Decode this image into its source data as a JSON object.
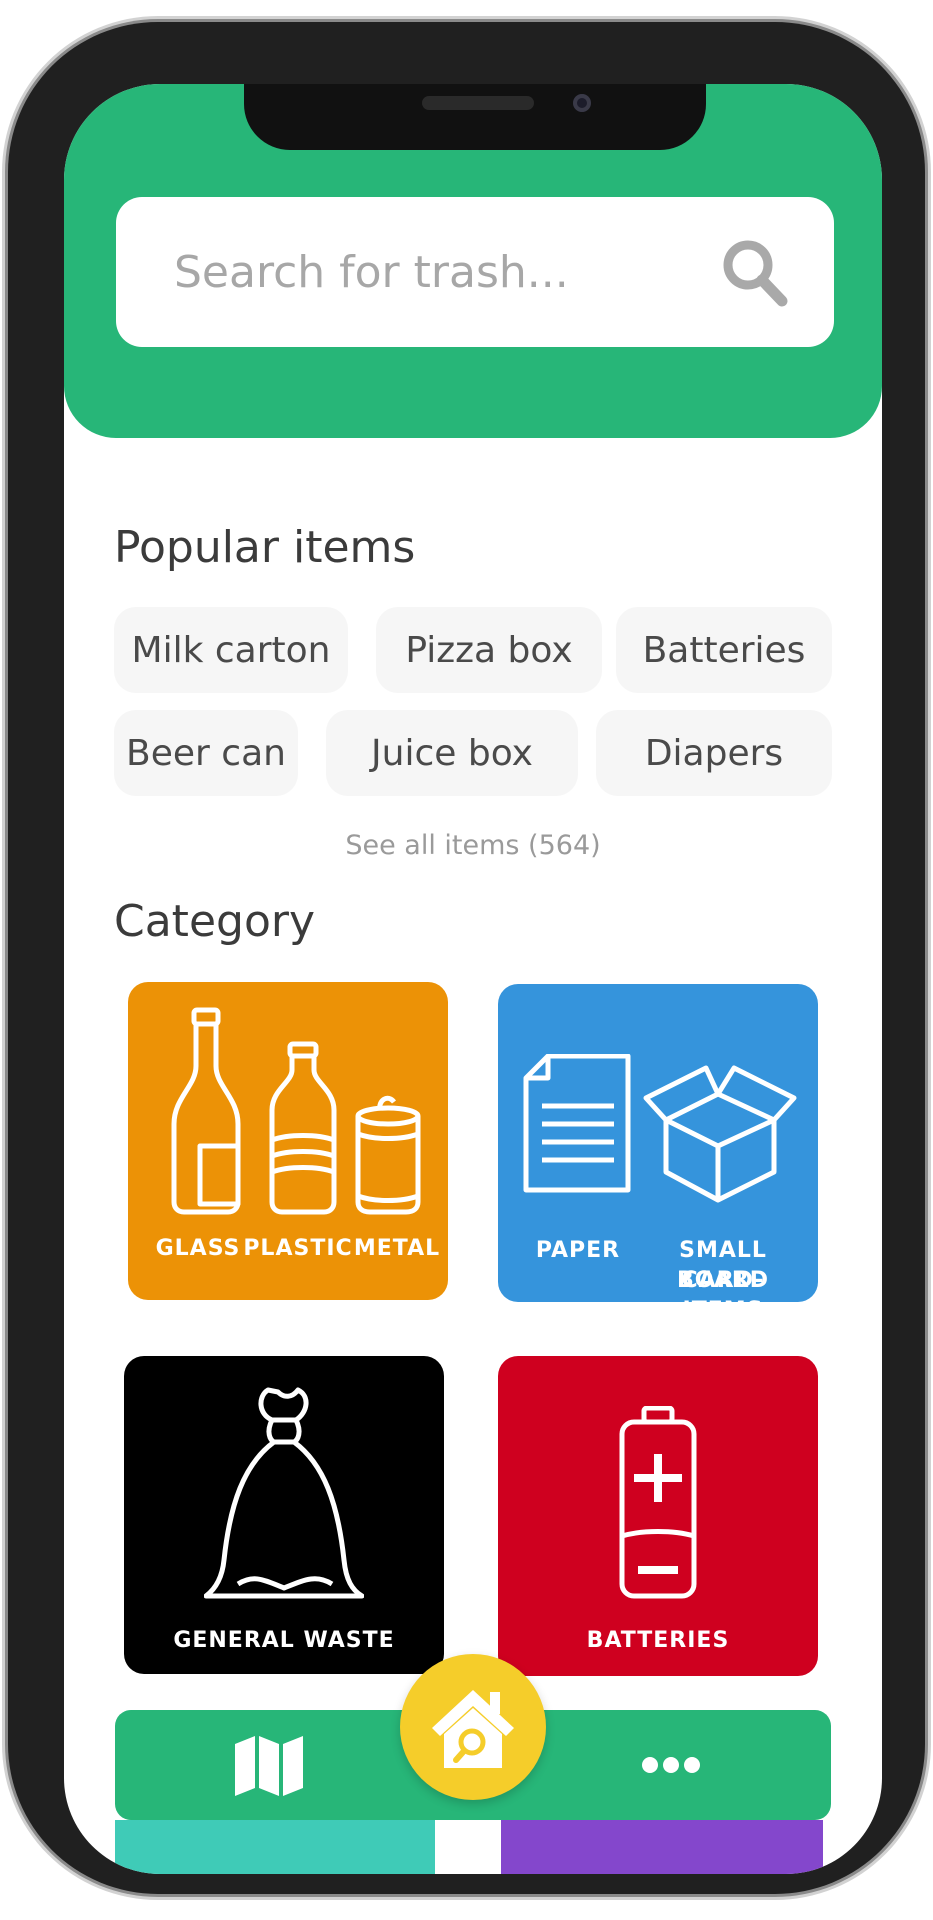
{
  "search": {
    "placeholder": "Search for trash...",
    "value": ""
  },
  "popular": {
    "title": "Popular items",
    "chips": [
      "Milk carton",
      "Pizza box",
      "Batteries",
      "Beer can",
      "Juice box",
      "Diapers"
    ],
    "see_all": "See all items (564)"
  },
  "category": {
    "title": "Category",
    "tiles": [
      {
        "labels": [
          "GLASS",
          "PLASTIC",
          "METAL"
        ],
        "color": "#ec9206",
        "icon": "bottles-can-icon"
      },
      {
        "labels": [
          "PAPER",
          "SMALL CARD-",
          "BOARD ITEMS"
        ],
        "color": "#3594dc",
        "icon": "paper-box-icon"
      },
      {
        "labels": [
          "GENERAL WASTE"
        ],
        "color": "#000000",
        "icon": "trash-bag-icon"
      },
      {
        "labels": [
          "BATTERIES"
        ],
        "color": "#cf001f",
        "icon": "battery-icon"
      }
    ]
  },
  "nav": {
    "items": [
      "map-icon",
      "home-search-icon",
      "more-icon"
    ],
    "accent": "#27b678",
    "fab_color": "#f5cd2a"
  }
}
